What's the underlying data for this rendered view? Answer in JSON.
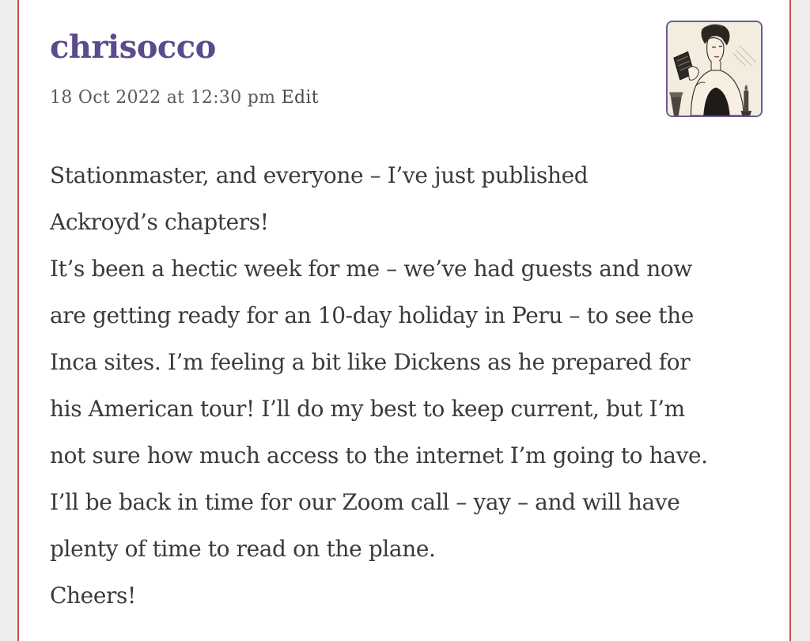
{
  "comment": {
    "author": "chrisocco",
    "date": "18 Oct 2022 at 12:30 pm",
    "edit_label": "Edit",
    "avatar_icon": "victorian-woman-reading-avatar",
    "lines": [
      "Stationmaster, and everyone – I’ve just published",
      "Ackroyd’s chapters!",
      "It’s been a hectic week for me – we’ve had guests and now",
      "are getting ready for an 10-day holiday in Peru – to see the",
      "Inca sites. I’m feeling a bit like Dickens as he prepared for",
      "his American tour! I’ll do my best to keep current, but I’m",
      "not sure how much access to the internet I’m going to have.",
      "I’ll be back in time for our Zoom call – yay – and will have",
      "plenty of time to read on the plane.",
      "Cheers!"
    ]
  },
  "colors": {
    "author": "#5b4a8c",
    "card_border": "#c9514a",
    "background": "#efeeec",
    "text": "#3a3a3a"
  }
}
